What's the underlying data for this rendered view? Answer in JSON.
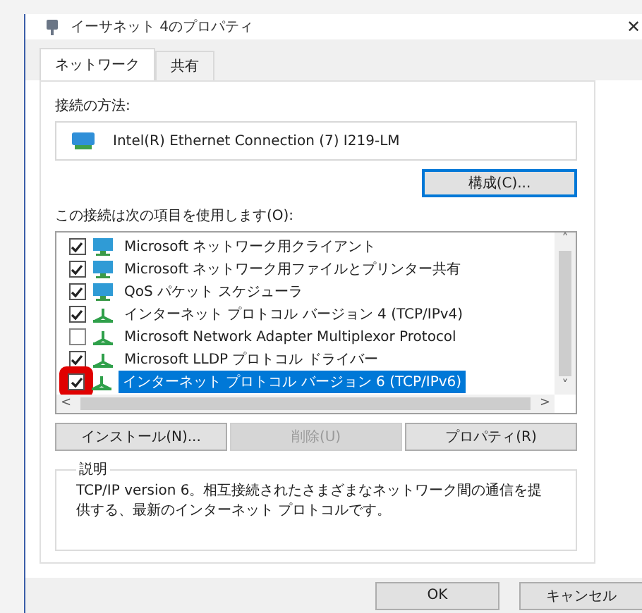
{
  "window": {
    "title": "イーサネット 4のプロパティ",
    "close": "✕"
  },
  "tabs": [
    {
      "label": "ネットワーク",
      "selected": true
    },
    {
      "label": "共有",
      "selected": false
    }
  ],
  "connect_using": {
    "label": "接続の方法:",
    "adapter": "Intel(R) Ethernet Connection (7) I219-LM",
    "configure_button": "構成(C)..."
  },
  "items_label": "この接続は次の項目を使用します(O):",
  "items": [
    {
      "kind": "client",
      "label": "Microsoft ネットワーク用クライアント",
      "checked": true,
      "selected": false,
      "marked": false
    },
    {
      "kind": "client",
      "label": "Microsoft ネットワーク用ファイルとプリンター共有",
      "checked": true,
      "selected": false,
      "marked": false
    },
    {
      "kind": "client",
      "label": "QoS パケット スケジューラ",
      "checked": true,
      "selected": false,
      "marked": false
    },
    {
      "kind": "protocol",
      "label": "インターネット プロトコル バージョン 4 (TCP/IPv4)",
      "checked": true,
      "selected": false,
      "marked": false
    },
    {
      "kind": "protocol",
      "label": "Microsoft Network Adapter Multiplexor Protocol",
      "checked": false,
      "selected": false,
      "marked": false
    },
    {
      "kind": "protocol",
      "label": "Microsoft LLDP プロトコル ドライバー",
      "checked": true,
      "selected": false,
      "marked": false
    },
    {
      "kind": "protocol",
      "label": "インターネット プロトコル バージョン 6 (TCP/IPv6)",
      "checked": true,
      "selected": true,
      "marked": true
    }
  ],
  "scroll_arrows": {
    "up": "˄",
    "down": "˅",
    "left": "<",
    "right": ">"
  },
  "item_buttons": [
    {
      "label": "インストール(N)...",
      "disabled": false
    },
    {
      "label": "削除(U)",
      "disabled": true
    },
    {
      "label": "プロパティ(R)",
      "disabled": false
    }
  ],
  "description": {
    "title": "説明",
    "text": "TCP/IP version 6。相互接続されたさまざまなネットワーク間の通信を提供する、最新のインターネット プロトコルです。"
  },
  "dialog_buttons": [
    "OK",
    "キャンセル"
  ]
}
